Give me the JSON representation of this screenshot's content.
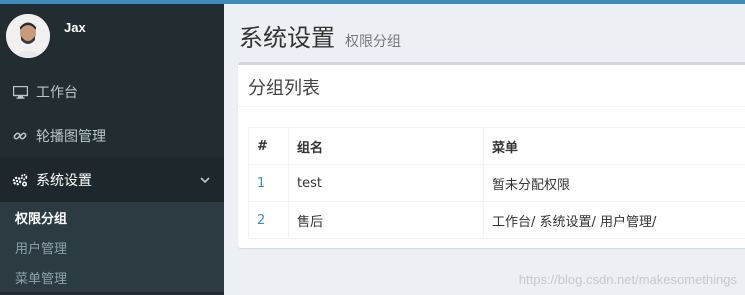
{
  "user": {
    "name": "Jax"
  },
  "sidebar": {
    "items": [
      {
        "label": "工作台",
        "icon": "monitor-icon"
      },
      {
        "label": "轮播图管理",
        "icon": "link-icon"
      },
      {
        "label": "系统设置",
        "icon": "gears-icon",
        "active": true,
        "children": [
          {
            "label": "权限分组",
            "active": true
          },
          {
            "label": "用户管理"
          },
          {
            "label": "菜单管理"
          }
        ]
      }
    ]
  },
  "header": {
    "title": "系统设置",
    "subtitle": "权限分组"
  },
  "box": {
    "title": "分组列表"
  },
  "table": {
    "columns": [
      "#",
      "组名",
      "菜单"
    ],
    "rows": [
      [
        "1",
        "test",
        "暂未分配权限"
      ],
      [
        "2",
        "售后",
        "工作台/ 系统设置/ 用户管理/"
      ]
    ]
  },
  "watermark": "https://blog.csdn.net/makesomethings",
  "colors": {
    "topbar": "#3c8dbc",
    "sidebar": "#222d32",
    "link": "#3c8dbc"
  }
}
